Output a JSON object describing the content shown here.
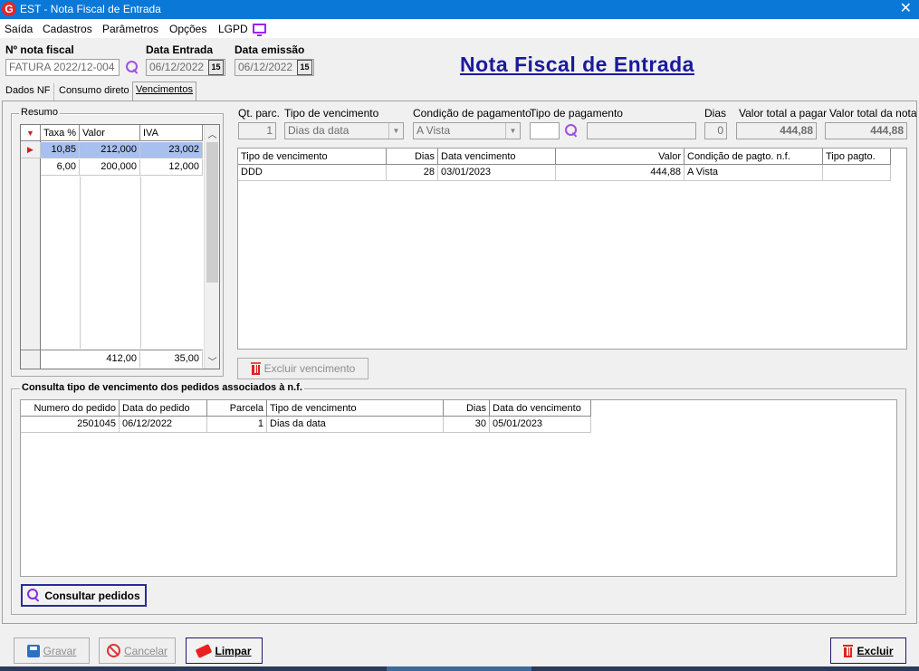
{
  "window": {
    "app_icon": "G",
    "title": "EST - Nota Fiscal de Entrada",
    "close_glyph": "✕"
  },
  "menu": {
    "items": [
      "Saída",
      "Cadastros",
      "Parâmetros",
      "Opções",
      "LGPD"
    ],
    "icon": "monitor-icon"
  },
  "header": {
    "nota_fiscal_label": "Nº nota fiscal",
    "nota_fiscal_value": "FATURA 2022/12-004",
    "data_entrada_label": "Data Entrada",
    "data_entrada_value": "06/12/2022",
    "data_emissao_label": "Data emissão",
    "data_emissao_value": "06/12/2022",
    "calendar_glyph": "15",
    "page_title": "Nota Fiscal de Entrada"
  },
  "tabs": [
    {
      "label": "Dados NF"
    },
    {
      "label": "Consumo direto"
    },
    {
      "label": "Vencimentos",
      "active": true
    }
  ],
  "resumo": {
    "title": "Resumo",
    "columns": [
      "Taxa %",
      "Valor",
      "IVA"
    ],
    "rows": [
      {
        "taxa": "10,85",
        "valor": "212,000",
        "iva": "23,002",
        "selected": true
      },
      {
        "taxa": "6,00",
        "valor": "200,000",
        "iva": "12,000"
      }
    ],
    "footer": {
      "valor": "412,00",
      "iva": "35,00"
    }
  },
  "parcelas": {
    "qt_parc_label": "Qt. parc.",
    "qt_parc_value": "1",
    "tipo_venc_label": "Tipo de vencimento",
    "tipo_venc_value": "Dias da data",
    "cond_pag_label": "Condição de pagamento",
    "cond_pag_value": "A Vista",
    "tipo_pag_label": "Tipo de pagamento",
    "tipo_pag_code": "",
    "tipo_pag_desc": "",
    "dias_label": "Dias",
    "dias_value": "0",
    "valor_pagar_label": "Valor total a pagar",
    "valor_pagar_value": "444,88",
    "valor_nota_label": "Valor total da nota",
    "valor_nota_value": "444,88"
  },
  "vencimentos": {
    "columns": [
      "Tipo de vencimento",
      "Dias",
      "Data vencimento",
      "Valor",
      "Condição de pagto. n.f.",
      "Tipo pagto."
    ],
    "rows": [
      {
        "tipo": "DDD",
        "dias": "28",
        "data": "03/01/2023",
        "valor": "444,88",
        "condicao": "A Vista",
        "tipo_pagto": ""
      }
    ],
    "excluir_label": "Excluir vencimento"
  },
  "consulta": {
    "title": "Consulta tipo de vencimento dos pedidos associados à n.f.",
    "columns": [
      "Numero do pedido",
      "Data do pedido",
      "Parcela",
      "Tipo de vencimento",
      "Dias",
      "Data do vencimento"
    ],
    "rows": [
      {
        "numero": "2501045",
        "data_pedido": "06/12/2022",
        "parcela": "1",
        "tipo": "Dias da data",
        "dias": "30",
        "data_venc": "05/01/2023"
      }
    ],
    "button_label": "Consultar pedidos"
  },
  "footer_buttons": {
    "gravar": "Gravar",
    "cancelar": "Cancelar",
    "limpar": "Limpar",
    "excluir": "Excluir"
  }
}
